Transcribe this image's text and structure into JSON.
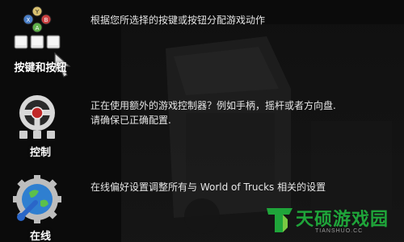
{
  "menu": [
    {
      "id": "keys",
      "label": "按键和按钮",
      "icon": "key-bindings-icon",
      "description": "根据您所选择的按键或按钮分配游戏动作"
    },
    {
      "id": "control",
      "label": "控制",
      "icon": "steering-wheel-icon",
      "description_line1": "正在使用额外的游戏控制器？例如手柄，摇杆或者方向盘.",
      "description_line2": "请确保已正确配置."
    },
    {
      "id": "online",
      "label": "在线",
      "icon": "globe-wrench-icon",
      "description": "在线偏好设置调整所有与 World of Trucks 相关的设置"
    }
  ],
  "gamepad_buttons": [
    "X",
    "Y",
    "A",
    "B"
  ],
  "watermark": {
    "logo_letter": "T",
    "text": "天硕游戏园",
    "subtext": "TIANSHUO.CC"
  },
  "colors": {
    "background": "#0c0c0c",
    "watermark_green": "#1fa53a"
  }
}
